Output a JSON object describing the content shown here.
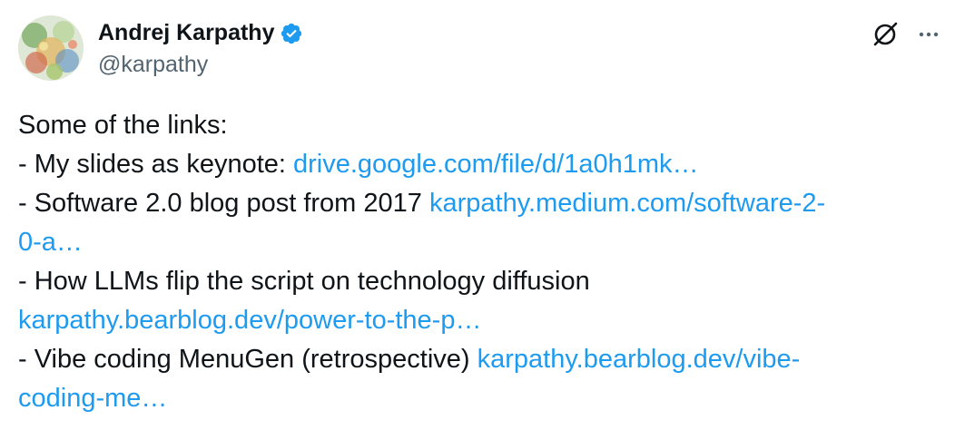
{
  "author": {
    "display_name": "Andrej Karpathy",
    "handle": "@karpathy",
    "avatar_icon": "avatar-image",
    "verified_icon": "verified-badge-icon",
    "verified_color": "#1d9bf0"
  },
  "actions": {
    "grok_icon": "grok-icon",
    "more_icon": "more-dots-icon"
  },
  "tweet": {
    "intro": "Some of the links:",
    "item1_text": "- My slides as keynote: ",
    "item1_link": "drive.google.com/file/d/1a0h1mk…",
    "item2_text": "- Software 2.0 blog post from 2017 ",
    "item2_link_a": "karpathy.medium.com/software-2-",
    "item2_link_b": "0-a…",
    "item3_text": "- How LLMs flip the script on technology diffusion",
    "item3_link": "karpathy.bearblog.dev/power-to-the-p…",
    "item4_text": "- Vibe coding MenuGen (retrospective) ",
    "item4_link_a": "karpathy.bearblog.dev/vibe-",
    "item4_link_b": "coding-me…",
    "link_color": "#1d9bf0",
    "text_color": "#0f1419"
  }
}
